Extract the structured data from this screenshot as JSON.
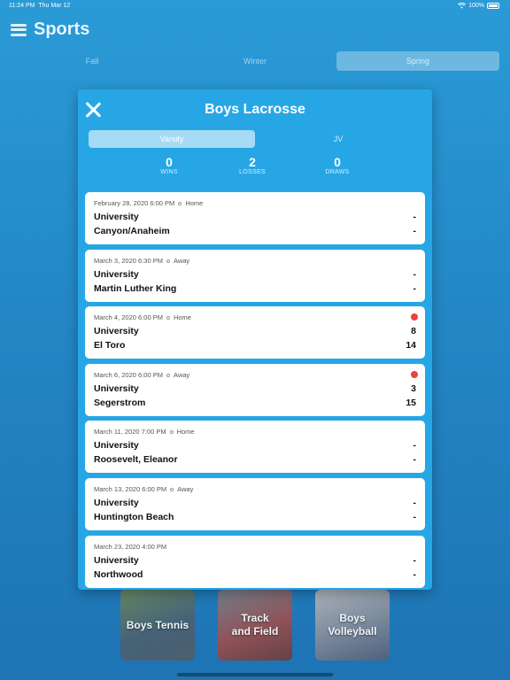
{
  "status_bar": {
    "time": "11:24 PM",
    "date": "Thu Mar 12",
    "battery": "100%"
  },
  "header": {
    "title": "Sports"
  },
  "season_tabs": [
    "Fall",
    "Winter",
    "Spring"
  ],
  "tiles": [
    "Boys Tennis",
    "Track\nand Field",
    "Boys\nVolleyball"
  ],
  "modal": {
    "title": "Boys Lacrosse",
    "level_tabs": [
      "Varsity",
      "JV"
    ],
    "record": {
      "wins": {
        "value": "0",
        "label": "WINS"
      },
      "losses": {
        "value": "2",
        "label": "LOSSES"
      },
      "draws": {
        "value": "0",
        "label": "DRAWS"
      }
    },
    "games": [
      {
        "datetime": "February 28, 2020 6:00 PM",
        "location": "Home",
        "home_team": "University",
        "home_score": "-",
        "away_team": "Canyon/Anaheim",
        "away_score": "-"
      },
      {
        "datetime": "March 3, 2020 6:30 PM",
        "location": "Away",
        "home_team": "University",
        "home_score": "-",
        "away_team": "Martin Luther King",
        "away_score": "-"
      },
      {
        "datetime": "March 4, 2020 6:00 PM",
        "location": "Home",
        "home_team": "University",
        "home_score": "8",
        "away_team": "El Toro",
        "away_score": "14"
      },
      {
        "datetime": "March 6, 2020 6:00 PM",
        "location": "Away",
        "home_team": "University",
        "home_score": "3",
        "away_team": "Segerstrom",
        "away_score": "15"
      },
      {
        "datetime": "March 11, 2020 7:00 PM",
        "location": "Home",
        "home_team": "University",
        "home_score": "-",
        "away_team": "Roosevelt, Eleanor",
        "away_score": "-"
      },
      {
        "datetime": "March 13, 2020 6:00 PM",
        "location": "Away",
        "home_team": "University",
        "home_score": "-",
        "away_team": "Huntington Beach",
        "away_score": "-"
      },
      {
        "datetime": "March 23, 2020 4:00 PM",
        "location": "",
        "home_team": "University",
        "home_score": "-",
        "away_team": "Northwood",
        "away_score": "-"
      }
    ]
  },
  "colors": {
    "background": "#2387c6",
    "modal": "#27a6e6",
    "loss_indicator": "#e5473d"
  }
}
